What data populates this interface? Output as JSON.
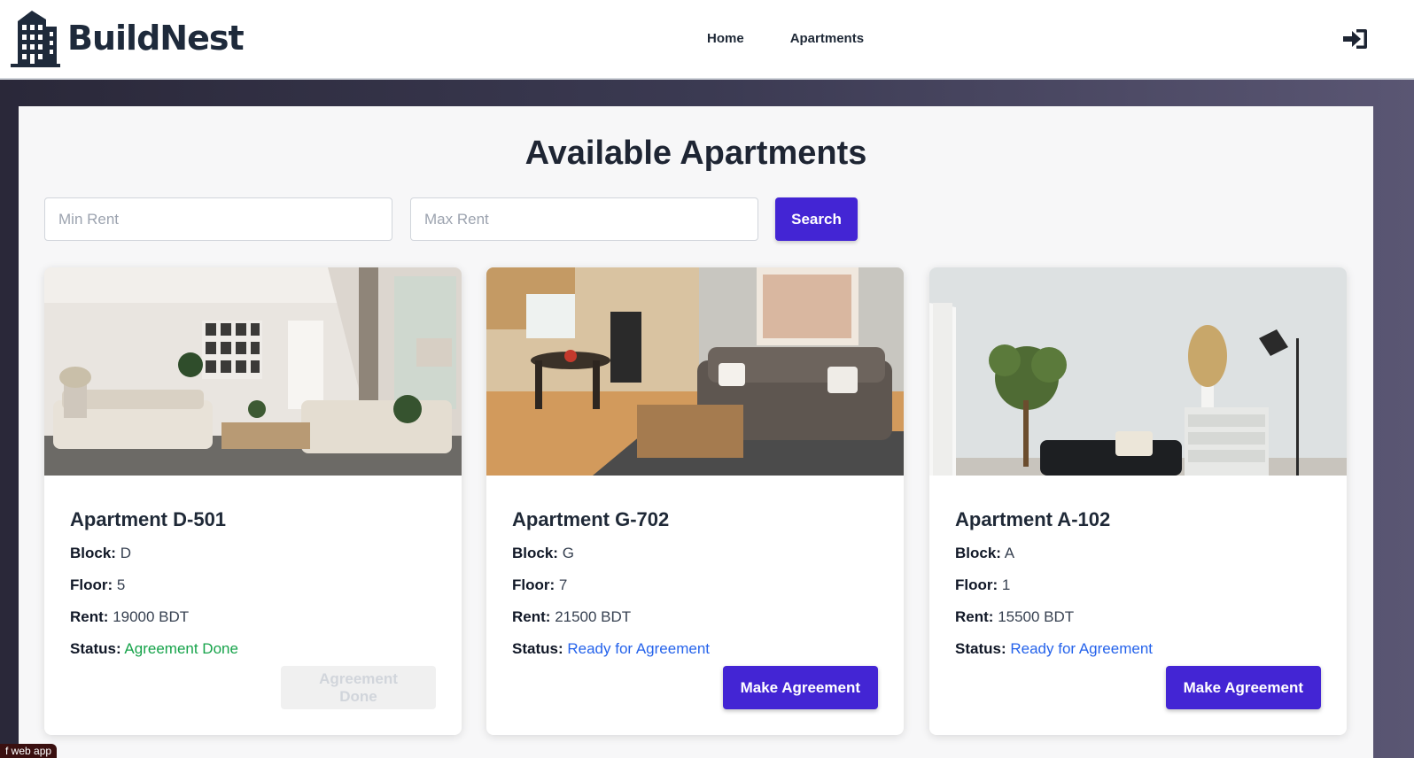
{
  "brand": {
    "name": "BuildNest",
    "logo_icon": "building-icon"
  },
  "nav": {
    "links": [
      "Home",
      "Apartments"
    ],
    "login_icon": "sign-in-icon"
  },
  "page": {
    "title": "Available Apartments"
  },
  "search": {
    "min_placeholder": "Min Rent",
    "max_placeholder": "Max Rent",
    "button_label": "Search"
  },
  "labels": {
    "block": "Block:",
    "floor": "Floor:",
    "rent": "Rent:",
    "status": "Status:"
  },
  "apartments": [
    {
      "title": "Apartment D-501",
      "block": "D",
      "floor": "5",
      "rent": "19000 BDT",
      "status": "Agreement Done",
      "button": "Agreement Done"
    },
    {
      "title": "Apartment G-702",
      "block": "G",
      "floor": "7",
      "rent": "21500 BDT",
      "status": "Ready for Agreement",
      "button": "Make Agreement"
    },
    {
      "title": "Apartment A-102",
      "block": "A",
      "floor": "1",
      "rent": "15500 BDT",
      "status": "Ready for Agreement",
      "button": "Make Agreement"
    }
  ],
  "tooltip": "f web app",
  "colors": {
    "primary": "#4325d4",
    "status_done": "#16a34a",
    "status_ready": "#2563eb",
    "brand_text": "#1e2a3b"
  }
}
